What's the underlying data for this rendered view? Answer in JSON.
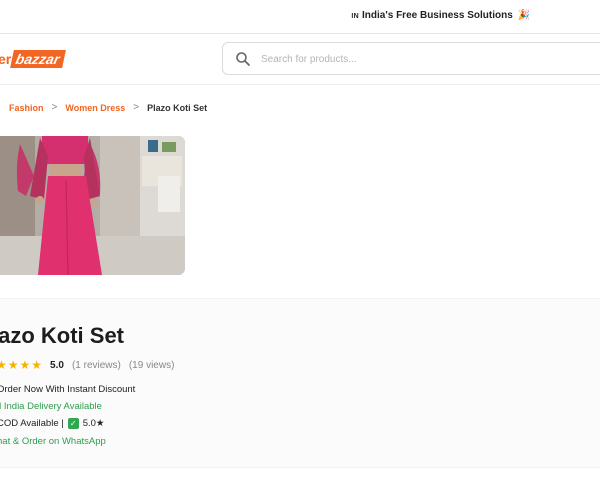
{
  "topbar": {
    "flag_code": "IN",
    "promo_text": "India's Free Business Solutions",
    "promo_emoji": "🎉"
  },
  "header": {
    "logo_part1": "er",
    "logo_part2": "bazzar",
    "search_placeholder": "Search for products..."
  },
  "breadcrumb": {
    "items": [
      "Fashion",
      "Women Dress"
    ],
    "current": "Plazo Koti Set"
  },
  "product": {
    "title": "lazo Koti Set",
    "stars": "★★★★",
    "rating": "5.0",
    "reviews": "(1 reviews)",
    "views": "(19 views)",
    "features": {
      "offer": "Order Now With Instant Discount",
      "delivery": "ll India Delivery Available",
      "cod_prefix": "COD Available |",
      "cod_check": "✓",
      "cod_score": "5.0★",
      "whatsapp": "hat & Order on WhatsApp"
    }
  },
  "colors": {
    "brand": "#f26522",
    "star": "#f5b301",
    "success": "#2e9e4d"
  }
}
